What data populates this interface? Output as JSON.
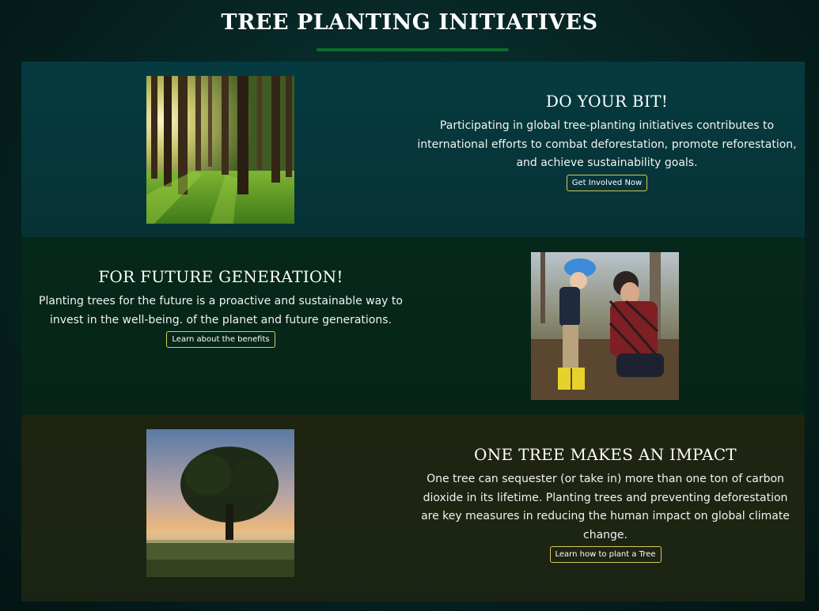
{
  "header": {
    "title": "TREE PLANTING INITIATIVES"
  },
  "sections": [
    {
      "heading": "DO YOUR BIT!",
      "body": "Participating in global tree-planting initiatives contributes to international efforts to combat deforestation, promote reforestation, and achieve sustainability goals.",
      "button_label": "Get Involved Now",
      "image": "sunlit-forest-photo"
    },
    {
      "heading": "FOR FUTURE GENERATION!",
      "body": "Planting trees for the future is a proactive and sustainable way to invest in the well-being. of the planet and future generations.",
      "button_label": "Learn about the benefits",
      "image": "father-child-planting-photo"
    },
    {
      "heading": "ONE TREE MAKES AN IMPACT",
      "body": "One tree can sequester (or take in) more than one ton of carbon dioxide in its lifetime. Planting trees and preventing deforestation are key measures in reducing the human impact on global climate change.",
      "button_label": "Learn how to plant a Tree",
      "image": "lone-tree-sunrise-photo"
    }
  ],
  "colors": {
    "underline": "#0d6b2b",
    "button_border": "#d6c85a"
  }
}
